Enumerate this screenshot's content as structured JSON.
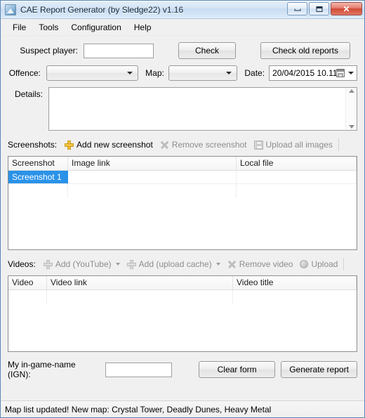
{
  "window": {
    "title": "CAE Report Generator (by Sledge22) v1.16",
    "app_icon": "picture-icon",
    "controls": {
      "minimize": "minimize-icon",
      "maximize": "maximize-icon",
      "close": "✕"
    }
  },
  "menu": {
    "items": [
      {
        "label": "File"
      },
      {
        "label": "Tools"
      },
      {
        "label": "Configuration"
      },
      {
        "label": "Help"
      }
    ]
  },
  "form": {
    "suspect_label": "Suspect player:",
    "suspect_value": "",
    "suspect_placeholder": "",
    "check_button": "Check",
    "check_old_button": "Check old reports",
    "offence_label": "Offence:",
    "offence_value": "",
    "map_label": "Map:",
    "map_value": "",
    "date_label": "Date:",
    "date_value": "20/04/2015 10.11",
    "details_label": "Details:",
    "details_value": ""
  },
  "screenshots": {
    "toolbar_label": "Screenshots:",
    "buttons": [
      {
        "label": "Add new screenshot",
        "icon": "plus-icon",
        "enabled": true
      },
      {
        "label": "Remove screenshot",
        "icon": "x-icon",
        "enabled": false
      },
      {
        "label": "Upload all images",
        "icon": "save-icon",
        "enabled": false
      }
    ],
    "columns": [
      "Screenshot",
      "Image link",
      "Local file"
    ],
    "rows": [
      {
        "screenshot": "Screenshot 1",
        "image_link": "",
        "local_file": "",
        "selected": true
      }
    ]
  },
  "videos": {
    "toolbar_label": "Videos:",
    "buttons": [
      {
        "label": "Add (YouTube)",
        "icon": "plus-icon",
        "enabled": false,
        "dropdown": true
      },
      {
        "label": "Add (upload cache)",
        "icon": "plus-icon",
        "enabled": false,
        "dropdown": true
      },
      {
        "label": "Remove video",
        "icon": "x-icon",
        "enabled": false,
        "dropdown": false
      },
      {
        "label": "Upload",
        "icon": "circle-icon",
        "enabled": false,
        "dropdown": false
      }
    ],
    "columns": [
      "Video",
      "Video link",
      "Video title"
    ],
    "rows": []
  },
  "footer": {
    "ign_label": "My in-game-name (IGN):",
    "ign_value": "",
    "clear_button": "Clear form",
    "generate_button": "Generate report"
  },
  "statusbar": {
    "text": "Map list updated! New map: Crystal Tower, Deadly Dunes, Heavy Metal"
  },
  "colors": {
    "selection_blue": "#2a92e8",
    "plus_gold": "#f5c445",
    "close_red": "#cf4a36",
    "window_bg": "#f0f0f0",
    "title_blue": "#d4e4f6"
  }
}
